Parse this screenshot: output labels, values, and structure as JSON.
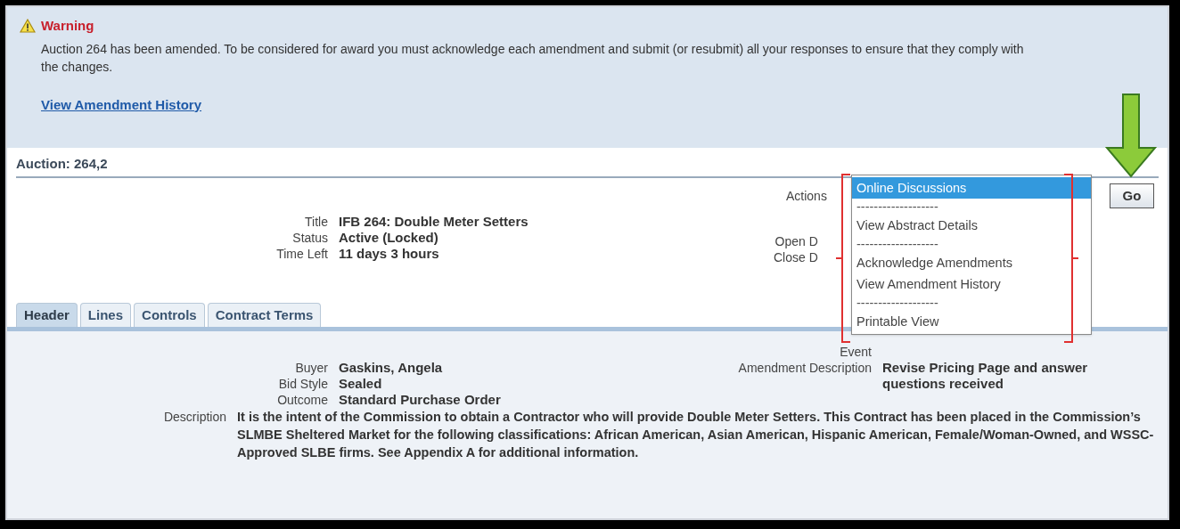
{
  "warning": {
    "title": "Warning",
    "message": "Auction 264 has been amended. To be considered for award you must acknowledge each amendment and submit (or resubmit) all your responses to ensure that they comply with the changes.",
    "link": "View Amendment History"
  },
  "auction_header": "Auction: 264,2",
  "actions": {
    "label": "Actions",
    "button": "Go",
    "menu": [
      {
        "kind": "option",
        "label": "Online Discussions",
        "selected": true
      },
      {
        "kind": "separator",
        "label": "-------------------"
      },
      {
        "kind": "option",
        "label": "View Abstract Details",
        "selected": false
      },
      {
        "kind": "separator",
        "label": "-------------------"
      },
      {
        "kind": "option",
        "label": "Acknowledge Amendments",
        "selected": false
      },
      {
        "kind": "option",
        "label": "View Amendment History",
        "selected": false
      },
      {
        "kind": "separator",
        "label": "-------------------"
      },
      {
        "kind": "option",
        "label": "Printable View",
        "selected": false
      }
    ]
  },
  "summary_fields": [
    {
      "label": "Title",
      "value": "IFB 264: Double Meter Setters"
    },
    {
      "label": "Status",
      "value": "Active (Locked)"
    },
    {
      "label": "Time Left",
      "value": "11 days 3 hours"
    }
  ],
  "date_fields": [
    {
      "label": "Open D"
    },
    {
      "label": "Close D"
    }
  ],
  "tabs": [
    {
      "label": "Header",
      "selected": true
    },
    {
      "label": "Lines",
      "selected": false
    },
    {
      "label": "Controls",
      "selected": false
    },
    {
      "label": "Contract Terms",
      "selected": false
    }
  ],
  "header_fields": [
    {
      "label": "Buyer",
      "value": "Gaskins, Angela"
    },
    {
      "label": "Bid Style",
      "value": "Sealed"
    },
    {
      "label": "Outcome",
      "value": "Standard Purchase Order"
    }
  ],
  "right_fields": [
    {
      "label": "Event"
    },
    {
      "label": "Amendment Description",
      "value": "Revise Pricing Page and answer questions received"
    }
  ],
  "description": {
    "label": "Description",
    "value": "It is the intent of the Commission to obtain a Contractor who will provide Double Meter Setters. This Contract has been placed in the Commission’s SLMBE Sheltered Market for the following classifications:  African American, Asian American, Hispanic American, Female/Woman-Owned, and WSSC-Approved SLBE firms.  See Appendix A for additional information."
  }
}
